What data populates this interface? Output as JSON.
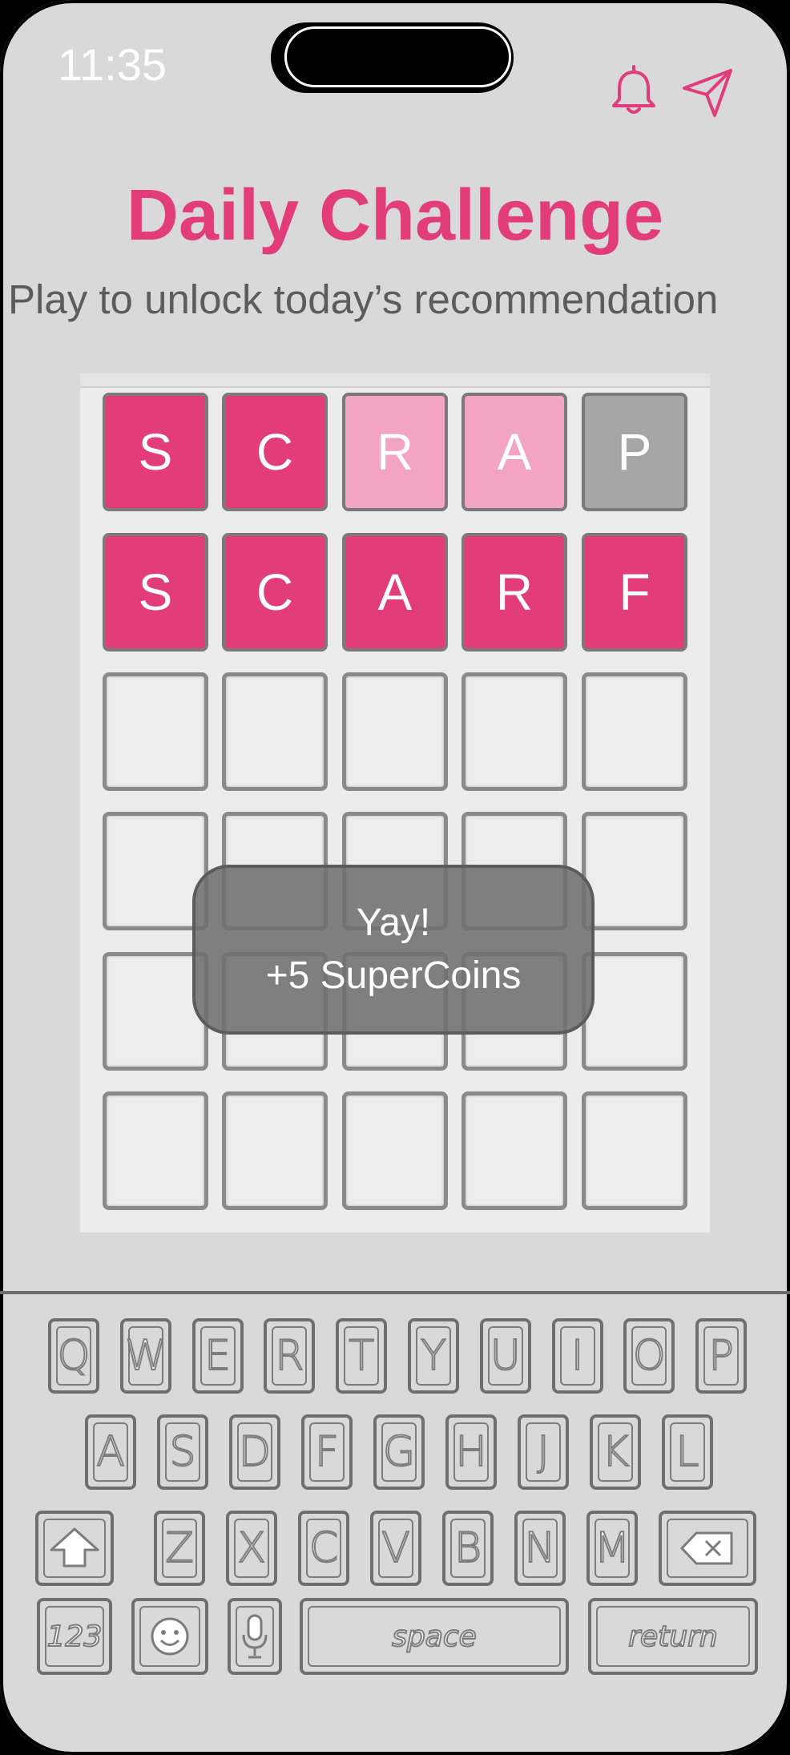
{
  "status_bar": {
    "time": "11:35"
  },
  "header_icons": [
    "bell-icon",
    "send-icon"
  ],
  "colors": {
    "accent": "#e23c7b",
    "present": "#f3a4c3",
    "absent": "#a6a6a6",
    "empty": "#ededed"
  },
  "header": {
    "title": "Daily Challenge",
    "subtitle": "Play to unlock today’s recommendation"
  },
  "board": {
    "rows": [
      [
        {
          "letter": "S",
          "state": "correct"
        },
        {
          "letter": "C",
          "state": "correct"
        },
        {
          "letter": "R",
          "state": "present"
        },
        {
          "letter": "A",
          "state": "present"
        },
        {
          "letter": "P",
          "state": "absent"
        }
      ],
      [
        {
          "letter": "S",
          "state": "correct"
        },
        {
          "letter": "C",
          "state": "correct"
        },
        {
          "letter": "A",
          "state": "correct"
        },
        {
          "letter": "R",
          "state": "correct"
        },
        {
          "letter": "F",
          "state": "correct"
        }
      ],
      [
        {
          "letter": "",
          "state": "empty"
        },
        {
          "letter": "",
          "state": "empty"
        },
        {
          "letter": "",
          "state": "empty"
        },
        {
          "letter": "",
          "state": "empty"
        },
        {
          "letter": "",
          "state": "empty"
        }
      ],
      [
        {
          "letter": "",
          "state": "empty"
        },
        {
          "letter": "",
          "state": "empty"
        },
        {
          "letter": "",
          "state": "empty"
        },
        {
          "letter": "",
          "state": "empty"
        },
        {
          "letter": "",
          "state": "empty"
        }
      ],
      [
        {
          "letter": "",
          "state": "empty"
        },
        {
          "letter": "",
          "state": "empty"
        },
        {
          "letter": "",
          "state": "empty"
        },
        {
          "letter": "",
          "state": "empty"
        },
        {
          "letter": "",
          "state": "empty"
        }
      ],
      [
        {
          "letter": "",
          "state": "empty"
        },
        {
          "letter": "",
          "state": "empty"
        },
        {
          "letter": "",
          "state": "empty"
        },
        {
          "letter": "",
          "state": "empty"
        },
        {
          "letter": "",
          "state": "empty"
        }
      ]
    ]
  },
  "toast": {
    "line1": "Yay!",
    "line2": "+5 SuperCoins"
  },
  "keyboard": {
    "row1": [
      "Q",
      "W",
      "E",
      "R",
      "T",
      "Y",
      "U",
      "I",
      "O",
      "P"
    ],
    "row2": [
      "A",
      "S",
      "D",
      "F",
      "G",
      "H",
      "J",
      "K",
      "L"
    ],
    "row3": [
      "Z",
      "X",
      "C",
      "V",
      "B",
      "N",
      "M"
    ],
    "shift_icon": "shift-arrow-icon",
    "delete_icon": "backspace-icon",
    "numbers_label": "123",
    "emoji_icon": "smiley-icon",
    "mic_icon": "microphone-icon",
    "space_label": "space",
    "return_label": "return"
  }
}
